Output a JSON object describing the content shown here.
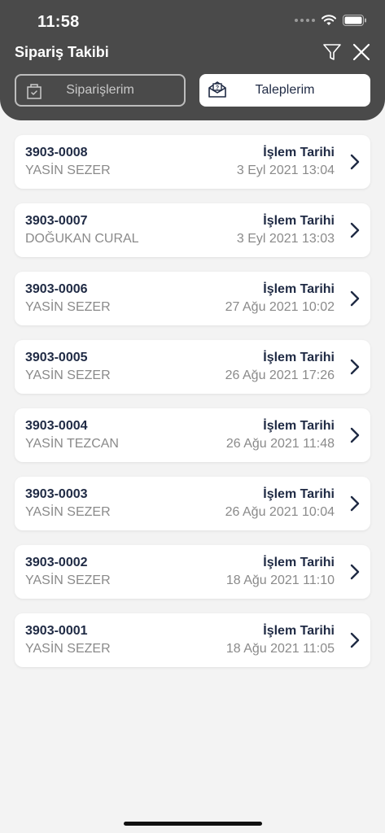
{
  "status_bar": {
    "time": "11:58"
  },
  "header": {
    "title": "Sipariş Takibi",
    "icons": [
      "filter-icon",
      "close-icon"
    ]
  },
  "segments": {
    "orders_label": "Siparişlerim",
    "requests_label": "Taleplerim",
    "selected": "requests"
  },
  "date_label": "İşlem Tarihi",
  "items": [
    {
      "code": "3903-0008",
      "name": "YASİN SEZER",
      "date": "3 Eyl 2021 13:04"
    },
    {
      "code": "3903-0007",
      "name": "DOĞUKAN CURAL",
      "date": "3 Eyl 2021 13:03"
    },
    {
      "code": "3903-0006",
      "name": "YASİN SEZER",
      "date": "27 Ağu 2021 10:02"
    },
    {
      "code": "3903-0005",
      "name": "YASİN SEZER",
      "date": "26 Ağu 2021 17:26"
    },
    {
      "code": "3903-0004",
      "name": "YASİN TEZCAN",
      "date": "26 Ağu 2021 11:48"
    },
    {
      "code": "3903-0003",
      "name": "YASİN SEZER",
      "date": "26 Ağu 2021 10:04"
    },
    {
      "code": "3903-0002",
      "name": "YASİN SEZER",
      "date": "18 Ağu 2021 11:10"
    },
    {
      "code": "3903-0001",
      "name": "YASİN SEZER",
      "date": "18 Ağu 2021 11:05"
    }
  ],
  "colors": {
    "header_bg": "#4a4a4a",
    "primary_text": "#1f2a44",
    "secondary_text": "#8a8a8a",
    "page_bg": "#f3f3f3"
  }
}
